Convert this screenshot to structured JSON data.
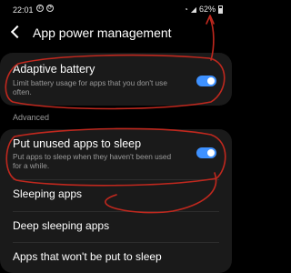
{
  "status_bar": {
    "time": "22:01",
    "battery": "62%",
    "icons": [
      "whatsapp-icon",
      "sync-icon",
      "wifi-icon",
      "signal-icon",
      "battery-icon"
    ]
  },
  "header": {
    "title": "App power management"
  },
  "adaptive_battery": {
    "title": "Adaptive battery",
    "description": "Limit battery usage for apps that you don't use often.",
    "toggle_on": true
  },
  "section_label": "Advanced",
  "put_to_sleep": {
    "title": "Put unused apps to sleep",
    "description": "Put apps to sleep when they haven't been used for a while.",
    "toggle_on": true
  },
  "list": {
    "sleeping_apps": "Sleeping apps",
    "deep_sleeping_apps": "Deep sleeping apps",
    "never_sleep": "Apps that won't be put to sleep"
  },
  "colors": {
    "accent": "#3e91ff",
    "annotation": "#c0281e",
    "background": "#000000",
    "card": "#1a1a1a"
  }
}
